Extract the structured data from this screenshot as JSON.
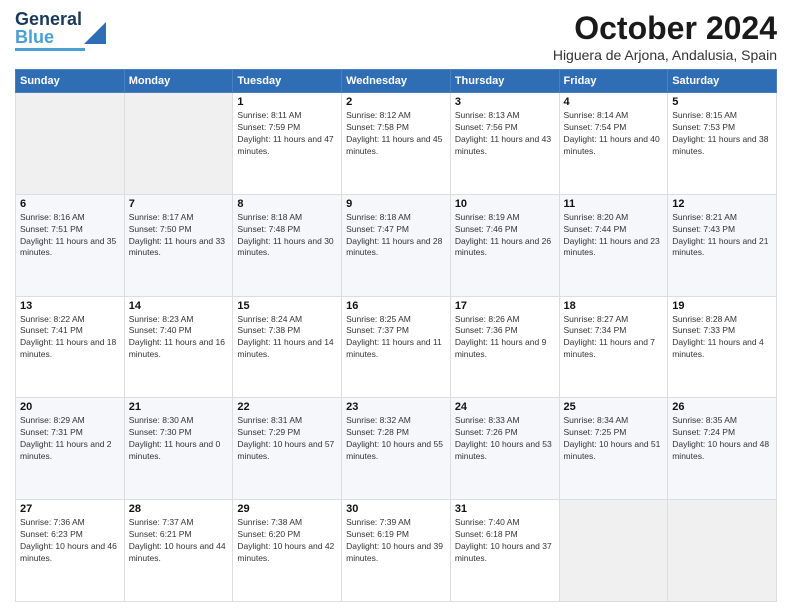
{
  "header": {
    "logo": {
      "line1": "General",
      "line2": "Blue"
    },
    "title": "October 2024",
    "subtitle": "Higuera de Arjona, Andalusia, Spain"
  },
  "calendar": {
    "days": [
      "Sunday",
      "Monday",
      "Tuesday",
      "Wednesday",
      "Thursday",
      "Friday",
      "Saturday"
    ],
    "weeks": [
      [
        {
          "day": "",
          "text": ""
        },
        {
          "day": "",
          "text": ""
        },
        {
          "day": "1",
          "text": "Sunrise: 8:11 AM\nSunset: 7:59 PM\nDaylight: 11 hours and 47 minutes."
        },
        {
          "day": "2",
          "text": "Sunrise: 8:12 AM\nSunset: 7:58 PM\nDaylight: 11 hours and 45 minutes."
        },
        {
          "day": "3",
          "text": "Sunrise: 8:13 AM\nSunset: 7:56 PM\nDaylight: 11 hours and 43 minutes."
        },
        {
          "day": "4",
          "text": "Sunrise: 8:14 AM\nSunset: 7:54 PM\nDaylight: 11 hours and 40 minutes."
        },
        {
          "day": "5",
          "text": "Sunrise: 8:15 AM\nSunset: 7:53 PM\nDaylight: 11 hours and 38 minutes."
        }
      ],
      [
        {
          "day": "6",
          "text": "Sunrise: 8:16 AM\nSunset: 7:51 PM\nDaylight: 11 hours and 35 minutes."
        },
        {
          "day": "7",
          "text": "Sunrise: 8:17 AM\nSunset: 7:50 PM\nDaylight: 11 hours and 33 minutes."
        },
        {
          "day": "8",
          "text": "Sunrise: 8:18 AM\nSunset: 7:48 PM\nDaylight: 11 hours and 30 minutes."
        },
        {
          "day": "9",
          "text": "Sunrise: 8:18 AM\nSunset: 7:47 PM\nDaylight: 11 hours and 28 minutes."
        },
        {
          "day": "10",
          "text": "Sunrise: 8:19 AM\nSunset: 7:46 PM\nDaylight: 11 hours and 26 minutes."
        },
        {
          "day": "11",
          "text": "Sunrise: 8:20 AM\nSunset: 7:44 PM\nDaylight: 11 hours and 23 minutes."
        },
        {
          "day": "12",
          "text": "Sunrise: 8:21 AM\nSunset: 7:43 PM\nDaylight: 11 hours and 21 minutes."
        }
      ],
      [
        {
          "day": "13",
          "text": "Sunrise: 8:22 AM\nSunset: 7:41 PM\nDaylight: 11 hours and 18 minutes."
        },
        {
          "day": "14",
          "text": "Sunrise: 8:23 AM\nSunset: 7:40 PM\nDaylight: 11 hours and 16 minutes."
        },
        {
          "day": "15",
          "text": "Sunrise: 8:24 AM\nSunset: 7:38 PM\nDaylight: 11 hours and 14 minutes."
        },
        {
          "day": "16",
          "text": "Sunrise: 8:25 AM\nSunset: 7:37 PM\nDaylight: 11 hours and 11 minutes."
        },
        {
          "day": "17",
          "text": "Sunrise: 8:26 AM\nSunset: 7:36 PM\nDaylight: 11 hours and 9 minutes."
        },
        {
          "day": "18",
          "text": "Sunrise: 8:27 AM\nSunset: 7:34 PM\nDaylight: 11 hours and 7 minutes."
        },
        {
          "day": "19",
          "text": "Sunrise: 8:28 AM\nSunset: 7:33 PM\nDaylight: 11 hours and 4 minutes."
        }
      ],
      [
        {
          "day": "20",
          "text": "Sunrise: 8:29 AM\nSunset: 7:31 PM\nDaylight: 11 hours and 2 minutes."
        },
        {
          "day": "21",
          "text": "Sunrise: 8:30 AM\nSunset: 7:30 PM\nDaylight: 11 hours and 0 minutes."
        },
        {
          "day": "22",
          "text": "Sunrise: 8:31 AM\nSunset: 7:29 PM\nDaylight: 10 hours and 57 minutes."
        },
        {
          "day": "23",
          "text": "Sunrise: 8:32 AM\nSunset: 7:28 PM\nDaylight: 10 hours and 55 minutes."
        },
        {
          "day": "24",
          "text": "Sunrise: 8:33 AM\nSunset: 7:26 PM\nDaylight: 10 hours and 53 minutes."
        },
        {
          "day": "25",
          "text": "Sunrise: 8:34 AM\nSunset: 7:25 PM\nDaylight: 10 hours and 51 minutes."
        },
        {
          "day": "26",
          "text": "Sunrise: 8:35 AM\nSunset: 7:24 PM\nDaylight: 10 hours and 48 minutes."
        }
      ],
      [
        {
          "day": "27",
          "text": "Sunrise: 7:36 AM\nSunset: 6:23 PM\nDaylight: 10 hours and 46 minutes."
        },
        {
          "day": "28",
          "text": "Sunrise: 7:37 AM\nSunset: 6:21 PM\nDaylight: 10 hours and 44 minutes."
        },
        {
          "day": "29",
          "text": "Sunrise: 7:38 AM\nSunset: 6:20 PM\nDaylight: 10 hours and 42 minutes."
        },
        {
          "day": "30",
          "text": "Sunrise: 7:39 AM\nSunset: 6:19 PM\nDaylight: 10 hours and 39 minutes."
        },
        {
          "day": "31",
          "text": "Sunrise: 7:40 AM\nSunset: 6:18 PM\nDaylight: 10 hours and 37 minutes."
        },
        {
          "day": "",
          "text": ""
        },
        {
          "day": "",
          "text": ""
        }
      ]
    ]
  }
}
